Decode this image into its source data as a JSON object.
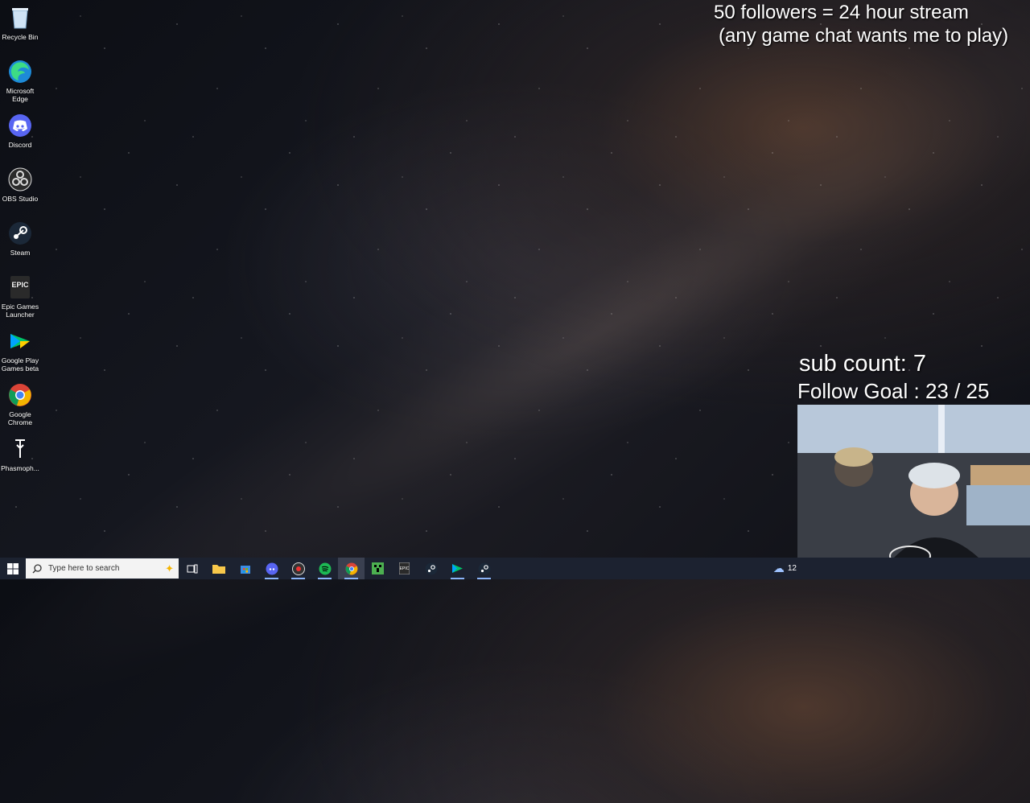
{
  "desktop_icons": [
    {
      "label": "Recycle Bin",
      "icon": "recycle-bin-icon"
    },
    {
      "label": "Microsoft Edge",
      "icon": "edge-icon"
    },
    {
      "label": "Discord",
      "icon": "discord-icon"
    },
    {
      "label": "OBS Studio",
      "icon": "obs-icon"
    },
    {
      "label": "Steam",
      "icon": "steam-icon"
    },
    {
      "label": "Epic Games Launcher",
      "icon": "epic-games-icon"
    },
    {
      "label": "Google Play Games beta",
      "icon": "google-play-games-icon"
    },
    {
      "label": "Google Chrome",
      "icon": "chrome-icon"
    },
    {
      "label": "Phasmoph...",
      "icon": "phasmophobia-icon"
    }
  ],
  "overlay": {
    "line1": "50 followers = 24 hour stream",
    "line2": "(any game chat wants me to play)",
    "sub_count": "sub count: 7",
    "follow_goal": "Follow Goal : 23 / 25"
  },
  "taskbar": {
    "search_placeholder": "Type here to search",
    "apps": [
      "task-view-icon",
      "file-explorer-icon",
      "microsoft-store-icon",
      "discord-icon",
      "obs-icon",
      "spotify-icon",
      "chrome-icon",
      "minecraft-icon",
      "epic-games-icon",
      "steam-icon",
      "google-play-games-icon",
      "steam-icon"
    ],
    "tray_time": "12"
  },
  "colors": {
    "taskbar": "#1c2230",
    "discord": "#5865f2",
    "spotify": "#1db954"
  }
}
